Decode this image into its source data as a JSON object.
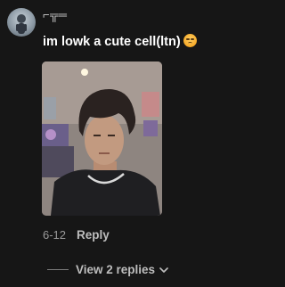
{
  "comment": {
    "username": "⌐╦═",
    "text": "im lowk a cute cell(ltn)",
    "emoji_icon": "pensive-face-emoji",
    "date": "6-12",
    "reply_label": "Reply",
    "view_replies_label": "View 2 replies"
  },
  "icons": {
    "view_replies": "chevron-down-icon"
  }
}
